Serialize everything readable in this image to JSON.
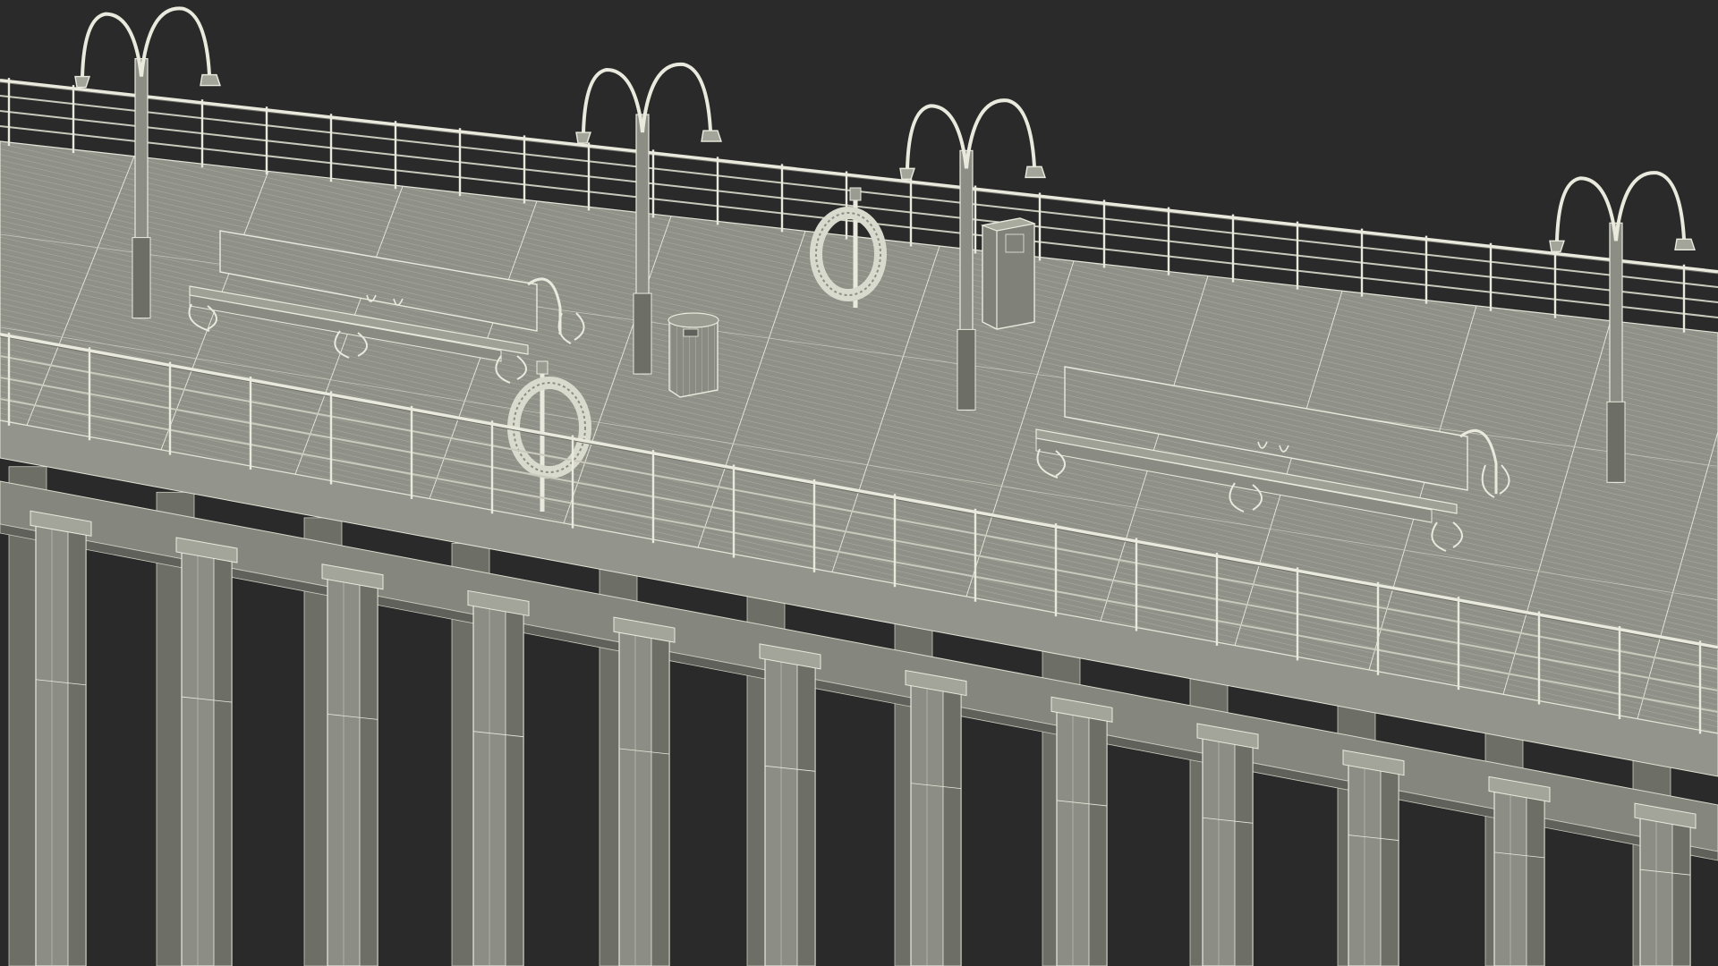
{
  "scene": {
    "subject": "pier-wireframe-render",
    "colors": {
      "background": "#2a2a2a",
      "surface": "#8c8e85",
      "surface_light": "#a3a59b",
      "surface_dark": "#6d6f67",
      "wire": "#e9eadd",
      "wire_dim": "#c9cabd"
    },
    "objects": {
      "piles": 12,
      "lamp_posts": 4,
      "benches": 2,
      "trash_bins": 1,
      "life_buoys": 2,
      "utility_boxes": 1
    }
  }
}
